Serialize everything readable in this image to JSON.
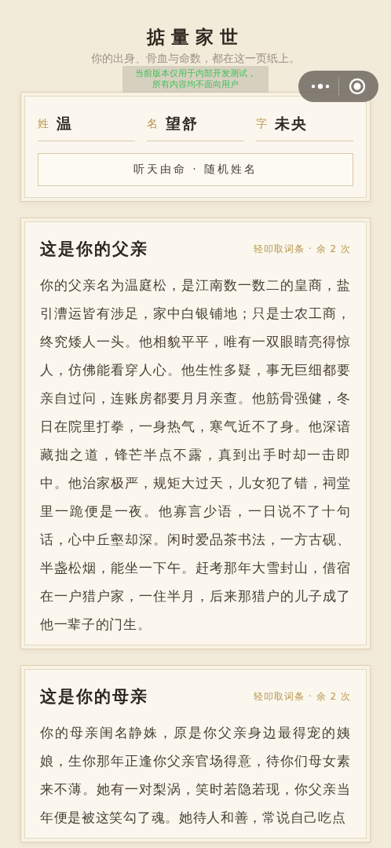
{
  "header": {
    "title": "掂量家世",
    "subtitle": "你的出身、骨血与命数，都在这一页纸上。"
  },
  "dev_notice": [
    "当前版本仅用于内部开发测试，",
    "所有内容均不面向用户"
  ],
  "name_card": {
    "fields": [
      {
        "label": "姓",
        "value": "温"
      },
      {
        "label": "名",
        "value": "望舒"
      },
      {
        "label": "字",
        "value": "未央"
      }
    ],
    "button": "听天由命 · 随机姓名"
  },
  "sections": [
    {
      "title": "这是你的父亲",
      "hint": "轻叩取词条 · 余 2 次",
      "text": "你的父亲名为温庭松，是江南数一数二的皇商，盐引漕运皆有涉足，家中白银铺地；只是士农工商，终究矮人一头。他相貌平平，唯有一双眼睛亮得惊人，仿佛能看穿人心。他生性多疑，事无巨细都要亲自过问，连账房都要月月亲查。他筋骨强健，冬日在院里打拳，一身热气，寒气近不了身。他深谙藏拙之道，锋芒半点不露，真到出手时却一击即中。他治家极严，规矩大过天，儿女犯了错，祠堂里一跪便是一夜。他寡言少语，一日说不了十句话，心中丘壑却深。闲时爱品茶书法，一方古砚、半盏松烟，能坐一下午。赶考那年大雪封山，借宿在一户猎户家，一住半月，后来那猎户的儿子成了他一辈子的门生。"
    },
    {
      "title": "这是你的母亲",
      "hint": "轻叩取词条 · 余 2 次",
      "text": "你的母亲闺名静姝，原是你父亲身边最得宠的姨娘，生你那年正逢你父亲官场得意，待你们母女素来不薄。她有一对梨涡，笑时若隐若现，你父亲当年便是被这笑勾了魂。她待人和善，常说自己吃点"
    }
  ]
}
